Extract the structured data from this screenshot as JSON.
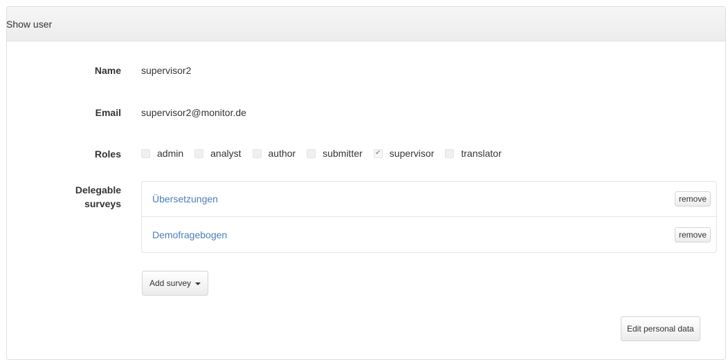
{
  "panel": {
    "title": "Show user"
  },
  "fields": {
    "name_label": "Name",
    "name_value": "supervisor2",
    "email_label": "Email",
    "email_value": "supervisor2@monitor.de",
    "roles_label": "Roles",
    "delegable_label_line1": "Delegable",
    "delegable_label_line2": "surveys"
  },
  "roles": [
    {
      "label": "admin",
      "checked": false
    },
    {
      "label": "analyst",
      "checked": false
    },
    {
      "label": "author",
      "checked": false
    },
    {
      "label": "submitter",
      "checked": false
    },
    {
      "label": "supervisor",
      "checked": true
    },
    {
      "label": "translator",
      "checked": false
    }
  ],
  "surveys": [
    {
      "title": "Übersetzungen",
      "remove_label": "remove"
    },
    {
      "title": "Demofragebogen",
      "remove_label": "remove"
    }
  ],
  "actions": {
    "add_survey_label": "Add survey",
    "edit_personal_data_label": "Edit personal data"
  },
  "icons": {
    "checkmark": "✔",
    "dropdown": "caret-down-icon"
  },
  "colors": {
    "link": "#4a7db8",
    "panel_heading_bg": "#efefef"
  }
}
